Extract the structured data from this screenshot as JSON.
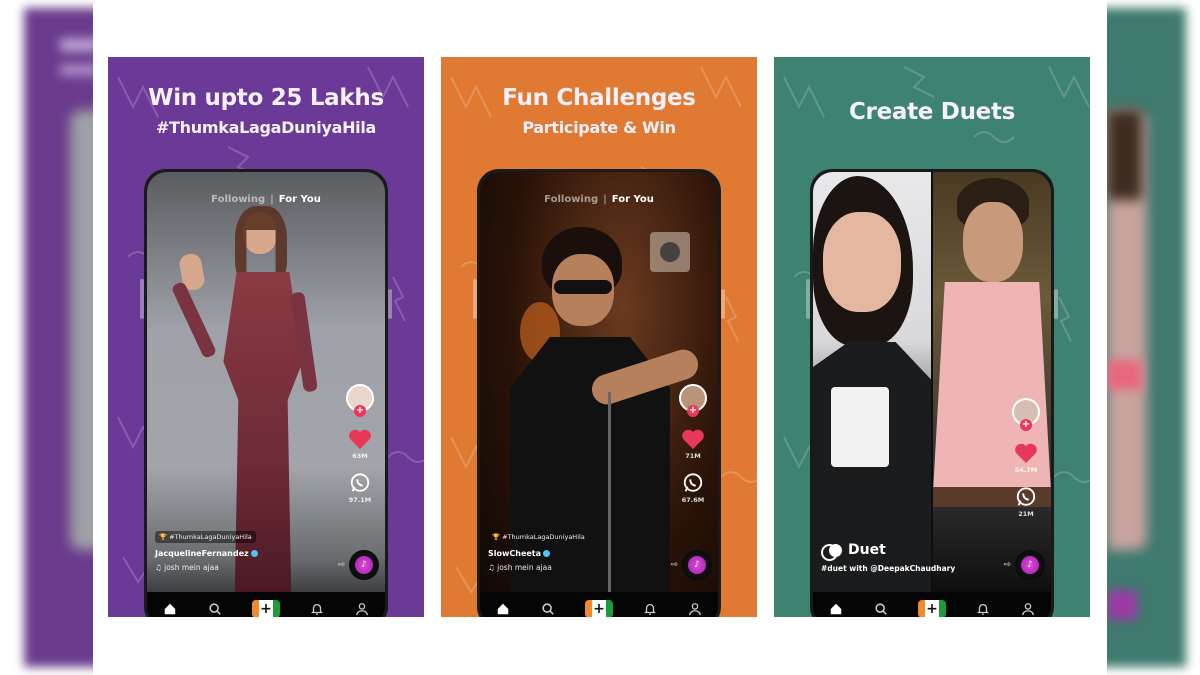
{
  "colors": {
    "panel_purple": "#6b3a96",
    "panel_orange": "#e07a33",
    "panel_teal": "#3e8272",
    "heart_pink": "#e8385a",
    "music_magenta": "#c234c6",
    "verified_blue": "#4fc3f7"
  },
  "feed_tabs": {
    "following": "Following",
    "separator": "|",
    "for_you": "For You"
  },
  "nav": {
    "home": "home-icon",
    "search": "search-icon",
    "create": "+",
    "notifications": "bell-icon",
    "profile": "profile-icon"
  },
  "panels": [
    {
      "headline": "Win upto 25 Lakhs",
      "subheadline": "#ThumkaLagaDuniyaHila",
      "hashtag_chip": "#ThumkaLagaDuniyaHila",
      "trophy_icon": "🏆",
      "username": "JacquelineFernandez",
      "sound": "josh mein ajaa",
      "likes": "63M",
      "shares": "97.1M"
    },
    {
      "headline": "Fun Challenges",
      "subheadline": "Participate & Win",
      "hashtag_chip": "#ThumkaLagaDuniyaHila",
      "trophy_icon": "🏆",
      "username": "SlowCheeta",
      "sound": "josh mein ajaa",
      "likes": "71M",
      "shares": "67.6M"
    },
    {
      "headline": "Create Duets",
      "duet_label": "Duet",
      "duet_caption": "#duet with @DeepakChaudhary",
      "likes": "54.7M",
      "shares": "21M"
    }
  ]
}
